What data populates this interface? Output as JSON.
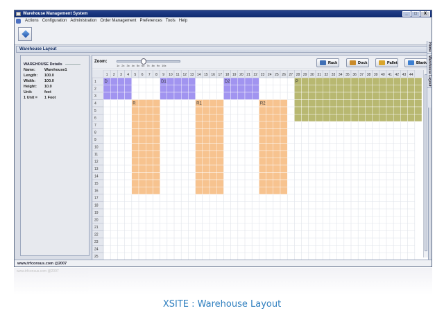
{
  "window": {
    "title": "Warehouse Management System",
    "minimize": "_",
    "maximize": "□",
    "close": "X"
  },
  "menu": [
    "Actions",
    "Configuration",
    "Administration",
    "Order Management",
    "Preferences",
    "Tools",
    "Help"
  ],
  "panel_title": "Warehouse Layout",
  "details": {
    "title": "WAREHOUSE Details",
    "rows": [
      {
        "label": "Name:",
        "value": "Warehouse1"
      },
      {
        "label": "Length:",
        "value": "100.0"
      },
      {
        "label": "Width:",
        "value": "100.0"
      },
      {
        "label": "Height:",
        "value": "10.0"
      },
      {
        "label": "Unit:",
        "value": "feet"
      },
      {
        "label": "1 Unit =",
        "value": "1 Foot"
      }
    ]
  },
  "zoom": {
    "label": "Zoom:",
    "ticks": [
      "1x",
      "2x",
      "3x",
      "4x",
      "5x",
      "6x",
      "7x",
      "8x",
      "9x",
      "10x"
    ],
    "level": 0.4
  },
  "buttons": [
    {
      "label": "Rack",
      "icon": "rack-icon",
      "color": "#3f6fb5"
    },
    {
      "label": "Dock",
      "icon": "dock-icon",
      "color": "#c98a2a"
    },
    {
      "label": "Pallet",
      "icon": "pallet-icon",
      "color": "#d9a52b"
    },
    {
      "label": "Blank",
      "icon": "blank-icon",
      "color": "#3c7fd1"
    }
  ],
  "grid": {
    "columns": 44,
    "rows": 25,
    "column_labels": [
      "1",
      "2",
      "3",
      "4",
      "5",
      "6",
      "7",
      "8",
      "9",
      "10",
      "11",
      "12",
      "13",
      "14",
      "15",
      "16",
      "17",
      "18",
      "19",
      "20",
      "21",
      "22",
      "23",
      "24",
      "25",
      "26",
      "27",
      "28",
      "29",
      "30",
      "31",
      "32",
      "33",
      "34",
      "35",
      "36",
      "37",
      "38",
      "39",
      "40",
      "41",
      "42",
      "43",
      "44"
    ],
    "row_labels": [
      "1",
      "2",
      "3",
      "4",
      "5",
      "6",
      "7",
      "8",
      "9",
      "10",
      "11",
      "12",
      "13",
      "14",
      "15",
      "16",
      "17",
      "18",
      "19",
      "20",
      "21",
      "22",
      "23",
      "24",
      "25"
    ],
    "objects": [
      {
        "label": "D",
        "type": "dock",
        "col": 1,
        "row": 1,
        "cols": 4,
        "rows": 3,
        "color": "#9d8ff0"
      },
      {
        "label": "D1",
        "type": "dock",
        "col": 9,
        "row": 1,
        "cols": 5,
        "rows": 3,
        "color": "#9d8ff0"
      },
      {
        "label": "D2",
        "type": "dock",
        "col": 18,
        "row": 1,
        "cols": 5,
        "rows": 3,
        "color": "#9d8ff0"
      },
      {
        "label": "P",
        "type": "pallet",
        "col": 28,
        "row": 1,
        "cols": 18,
        "rows": 6,
        "color": "#b5b56a"
      },
      {
        "label": "R",
        "type": "rack",
        "col": 5,
        "row": 4,
        "cols": 4,
        "rows": 13,
        "color": "#f7c08a"
      },
      {
        "label": "R1",
        "type": "rack",
        "col": 14,
        "row": 4,
        "cols": 4,
        "rows": 13,
        "color": "#f7c08a"
      },
      {
        "label": "R2",
        "type": "rack",
        "col": 23,
        "row": 4,
        "cols": 4,
        "rows": 13,
        "color": "#f7c08a"
      }
    ]
  },
  "side_tabs": [
    "Home",
    "Warehouse Layout"
  ],
  "status": "www.trfconsus.com @2007",
  "reflection_text": "www.trfconsus.com @2007",
  "caption": "XSITE : Warehouse Layout"
}
